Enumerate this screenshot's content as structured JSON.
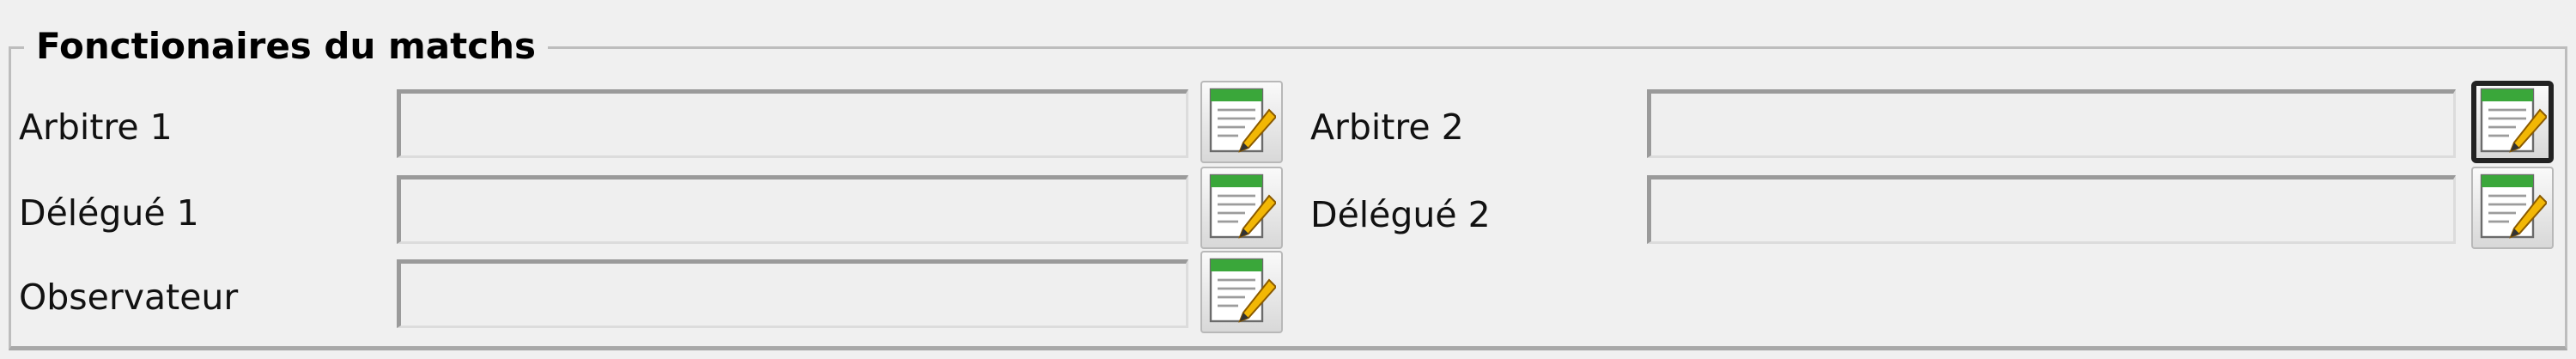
{
  "section": {
    "title": "Fonctionaires du matchs"
  },
  "officials": [
    {
      "label": "Arbitre 1",
      "value": "",
      "button_icon": "edit-notepad-icon"
    },
    {
      "label": "Arbitre 2",
      "value": "",
      "button_icon": "edit-notepad-icon"
    },
    {
      "label": "Délégué 1",
      "value": "",
      "button_icon": "edit-notepad-icon"
    },
    {
      "label": "Délégué 2",
      "value": "",
      "button_icon": "edit-notepad-icon"
    },
    {
      "label": "Observateur",
      "value": "",
      "button_icon": "edit-notepad-icon"
    }
  ],
  "colors": {
    "background": "#f0f0f0",
    "field_bg": "#efefef",
    "icon_header_green": "#3aa73a",
    "pencil_yellow": "#f2b705"
  }
}
